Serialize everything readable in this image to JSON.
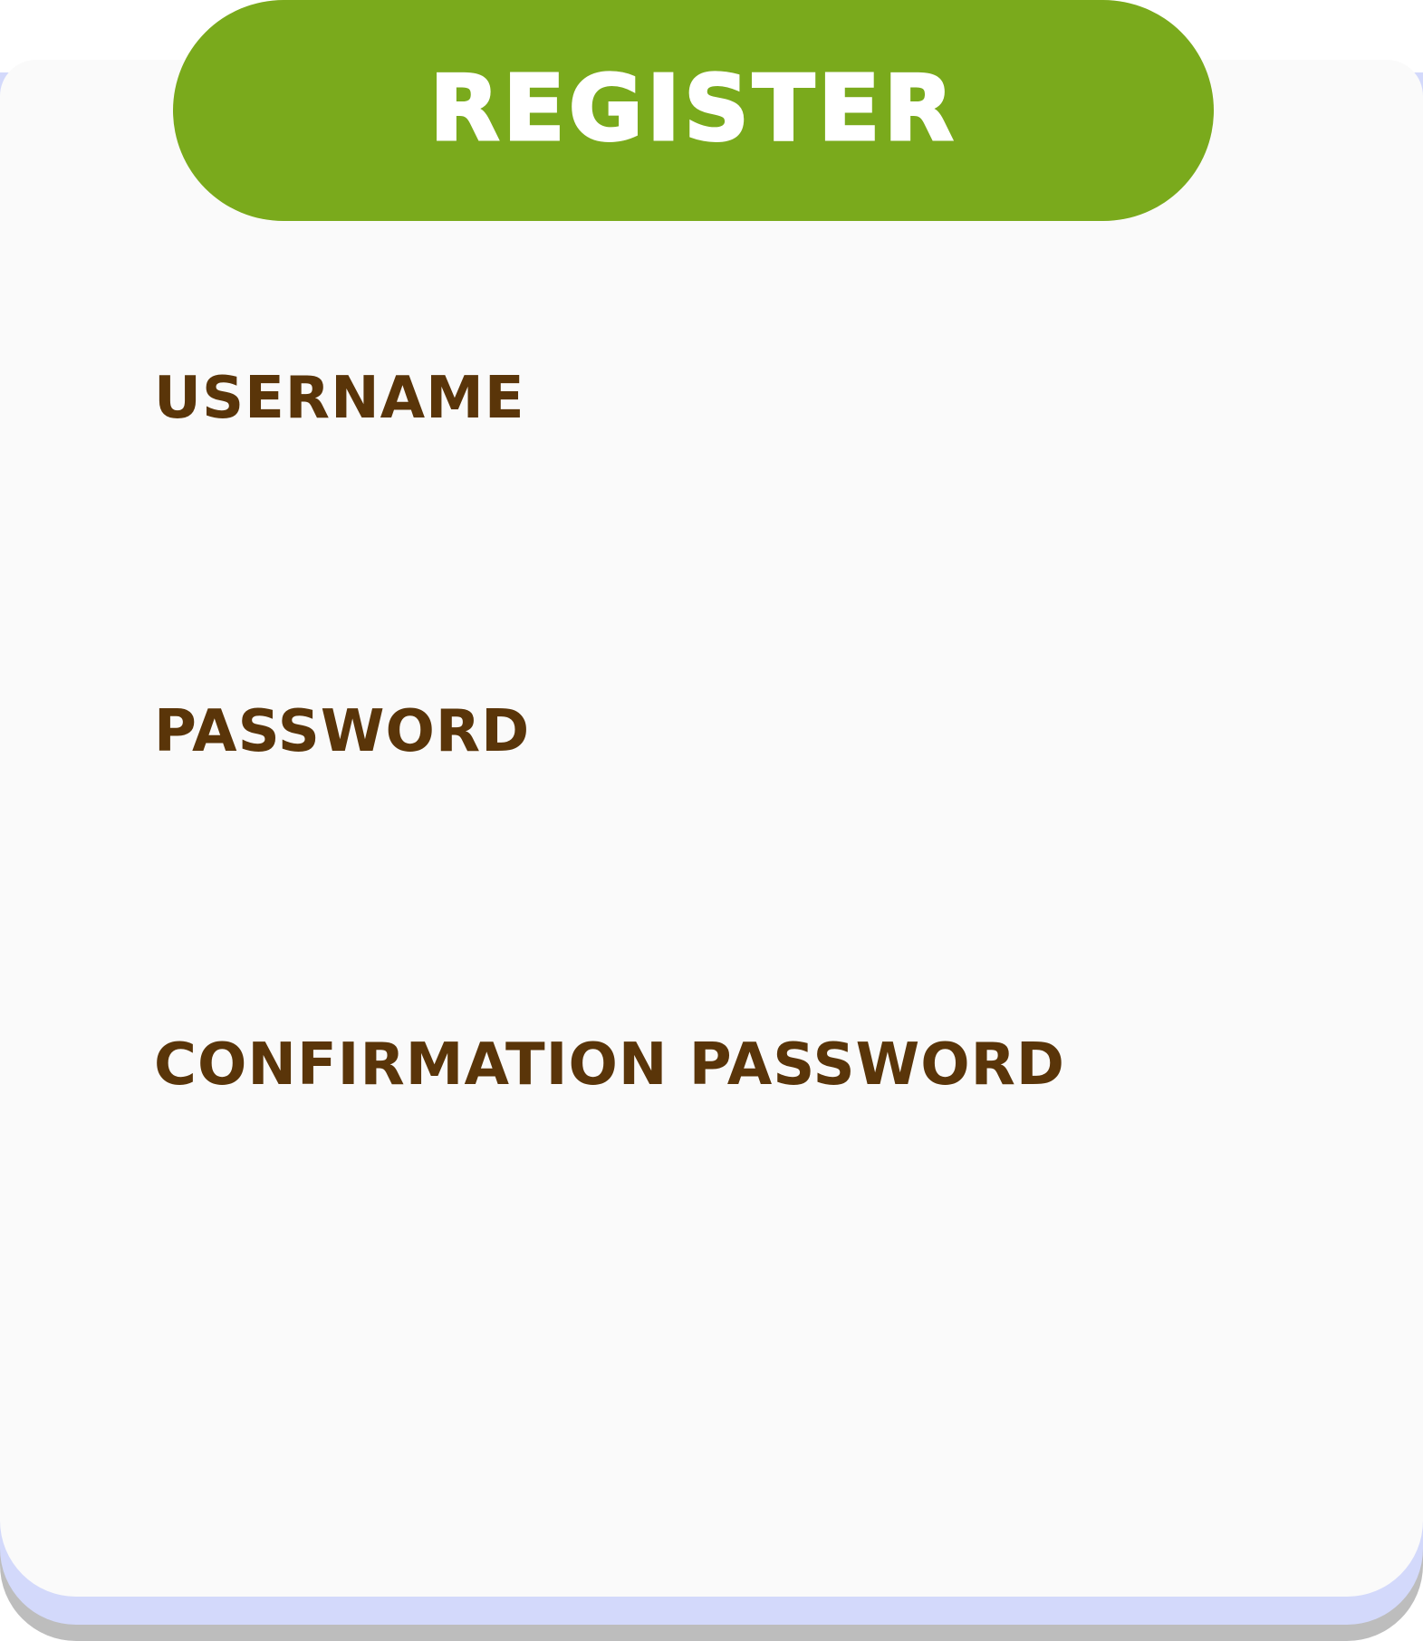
{
  "header": {
    "title": "REGISTER"
  },
  "form": {
    "fields": [
      {
        "label": "USERNAME",
        "value": "",
        "placeholder": ""
      },
      {
        "label": "PASSWORD",
        "value": "",
        "placeholder": ""
      },
      {
        "label": "CONFIRMATION PASSWORD",
        "value": "",
        "placeholder": ""
      }
    ]
  },
  "colors": {
    "header_green": "#7aaa1c",
    "label_brown": "#5a3509",
    "card_background": "#fafafa",
    "card_edge_blue": "#d3d9fb",
    "card_edge_gray": "#bdbdbd"
  }
}
